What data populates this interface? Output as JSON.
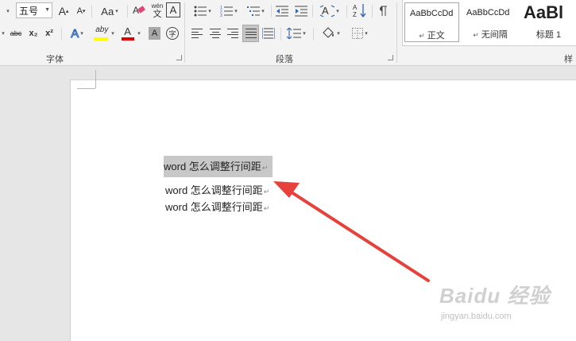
{
  "font_group": {
    "label": "字体",
    "font_size_value": "五号",
    "grow_font_label": "A",
    "shrink_font_label": "A",
    "change_case_label": "Aa",
    "phonetic_label_top": "wén",
    "phonetic_label_bottom": "文",
    "border_label": "A",
    "strikethrough_label": "abc",
    "subscript_label": "x₂",
    "superscript_label": "x²",
    "text_effects_label": "A",
    "highlight_label": "aby",
    "font_color_label": "A",
    "shading_label": "A",
    "enclose_label": "字"
  },
  "paragraph_group": {
    "label": "段落"
  },
  "styles_group": {
    "label": "样式",
    "items": [
      {
        "preview": "AaBbCcDd",
        "name": "正文"
      },
      {
        "preview": "AaBbCcDd",
        "name": "无间隔"
      },
      {
        "preview": "AaBl",
        "name": "标题 1"
      }
    ]
  },
  "document": {
    "lines": [
      {
        "text": "word 怎么调整行间距",
        "selected": true
      },
      {
        "text": "word 怎么调整行间距",
        "selected": false
      },
      {
        "text": "word 怎么调整行间距",
        "selected": false
      }
    ]
  },
  "colors": {
    "highlight_bar": "#ffff00",
    "font_color_bar": "#e00000",
    "arrow": "#e8403a",
    "selection": "#c8c8c8"
  },
  "watermark": {
    "logo_text": "Baidu 经验",
    "url": "jingyan.baidu.com"
  }
}
